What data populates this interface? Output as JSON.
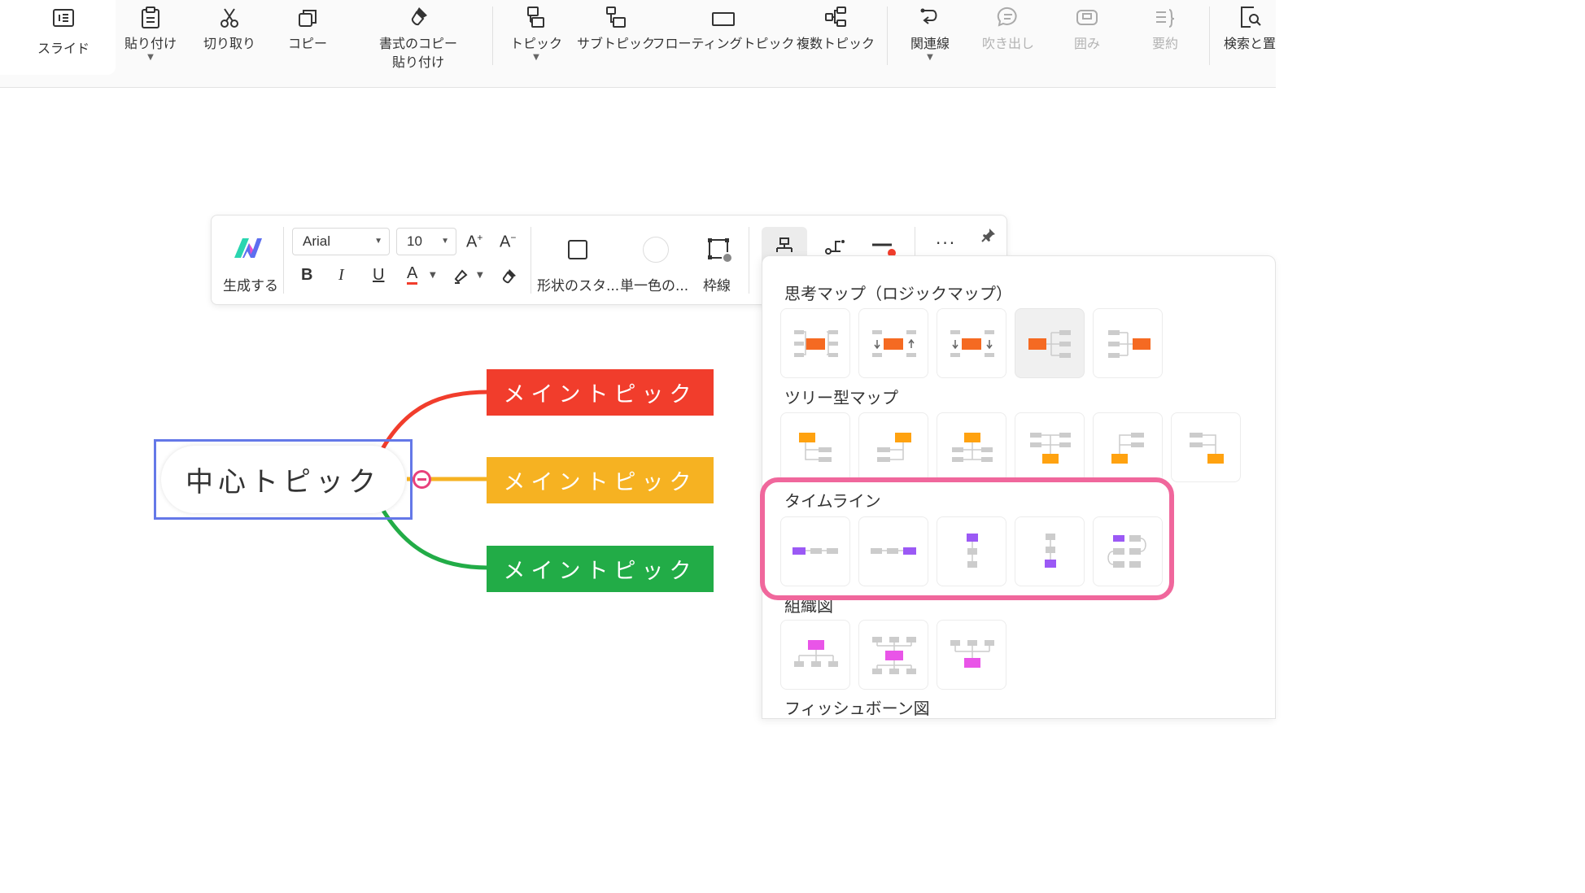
{
  "ribbon": {
    "slide": "スライド",
    "paste": "貼り付け",
    "cut": "切り取り",
    "copy": "コピー",
    "format_copy_1": "書式のコピー",
    "format_copy_2": "貼り付け",
    "topic": "トピック",
    "subtopic": "サブトピック",
    "floating_topic": "フローティングトピック",
    "multi_topic": "複数トピック",
    "relation": "関連線",
    "callout": "吹き出し",
    "boundary": "囲み",
    "summary": "要約",
    "find_replace": "検索と置"
  },
  "float_toolbar": {
    "generate": "生成する",
    "font": "Arial",
    "size": "10",
    "grow": "A",
    "shrink": "A",
    "bold": "B",
    "italic": "I",
    "underline": "U",
    "font_color": "A",
    "shape_style": "形状のスタ...",
    "fill": "単一色の...",
    "border": "枠線"
  },
  "layout_panel": {
    "logic_map": "思考マップ（ロジックマップ）",
    "tree_map": "ツリー型マップ",
    "timeline": "タイムライン",
    "org_chart": "組織図",
    "fishbone": "フィッシュボーン図"
  },
  "mindmap": {
    "central": "中心トピック",
    "main1": "メイントピック",
    "main2": "メイントピック",
    "main3": "メイントピック"
  },
  "colors": {
    "main1": "#f13d2c",
    "main2": "#f6b222",
    "main3": "#22ac47",
    "selection": "#6478e8",
    "highlight": "#f0679c",
    "timeline": "#9b59f5",
    "org": "#e955e8",
    "logic": "#f56a22",
    "tree": "#ffa210"
  }
}
